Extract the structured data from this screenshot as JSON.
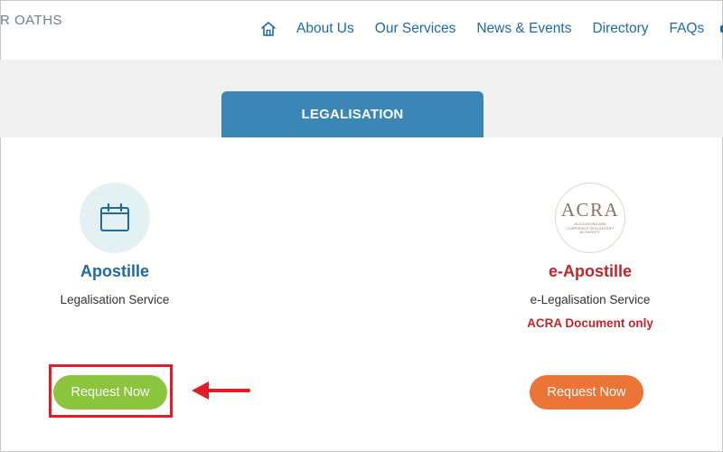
{
  "header": {
    "brand_fragment": "R OATHS",
    "nav": [
      {
        "label": "About Us"
      },
      {
        "label": "Our Services"
      },
      {
        "label": "News & Events"
      },
      {
        "label": "Directory"
      },
      {
        "label": "FAQs"
      }
    ],
    "home_icon": "home-icon"
  },
  "section": {
    "tab_label": "LEGALISATION"
  },
  "services": [
    {
      "title": "Apostille",
      "subtitle": "Legalisation Service",
      "icon": "calendar-icon",
      "button_label": "Request Now",
      "button_color": "#8bc43d"
    },
    {
      "title": "e-Apostille",
      "subtitle": "e-Legalisation Service",
      "note": "ACRA Document only",
      "logo_text": "ACRA",
      "logo_subtext": "ACCOUNTING AND CORPORATE REGULATORY AUTHORITY",
      "button_label": "Request Now",
      "button_color": "#ec7436"
    }
  ],
  "annotation": {
    "highlight_color": "#e21d24",
    "arrow_icon": "left-arrow-icon"
  },
  "colors": {
    "primary_blue": "#1f6aa5",
    "tab_blue": "#3a87b7",
    "alert_red": "#c0262a"
  }
}
